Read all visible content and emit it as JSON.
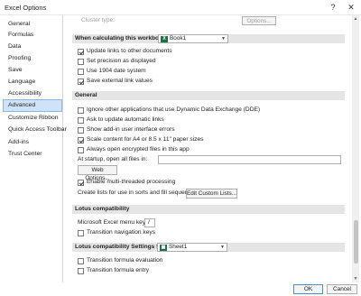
{
  "window": {
    "title": "Excel Options",
    "help": "?",
    "close": "✕"
  },
  "sidebar": {
    "items": [
      {
        "label": "General"
      },
      {
        "label": "Formulas"
      },
      {
        "label": "Data"
      },
      {
        "label": "Proofing"
      },
      {
        "label": "Save"
      },
      {
        "label": "Language"
      },
      {
        "label": "Accessibility"
      },
      {
        "label": "Advanced"
      },
      {
        "label": "Customize Ribbon"
      },
      {
        "label": "Quick Access Toolbar"
      },
      {
        "label": "Add-ins"
      },
      {
        "label": "Trust Center"
      }
    ],
    "active_index": 7
  },
  "content": {
    "cluster": {
      "label": "Cluster type:",
      "button": "Options..."
    },
    "calc_section": {
      "title": "When calculating this workbook:",
      "workbook": "Book1"
    },
    "calc_options": [
      {
        "label": "Update links to other documents",
        "checked": true
      },
      {
        "label": "Set precision as displayed",
        "checked": false
      },
      {
        "label": "Use 1904 date system",
        "checked": false
      },
      {
        "label": "Save external link values",
        "checked": true
      }
    ],
    "general_section": {
      "title": "General"
    },
    "general_options": [
      {
        "label": "Ignore other applications that use Dynamic Data Exchange (DDE)",
        "checked": false
      },
      {
        "label": "Ask to update automatic links",
        "checked": false
      },
      {
        "label": "Show add-in user interface errors",
        "checked": false
      },
      {
        "label": "Scale content for A4 or 8.5 x 11\" paper sizes",
        "checked": true
      },
      {
        "label": "Always open encrypted files in this app",
        "checked": false
      }
    ],
    "startup": {
      "label": "At startup, open all files in:",
      "value": ""
    },
    "web_options_button": "Web Options...",
    "multithreaded": {
      "label": "Enable multi-threaded processing",
      "checked": true
    },
    "custom_lists": {
      "label": "Create lists for use in sorts and fill sequences:",
      "button": "Edit Custom Lists..."
    },
    "lotus_section": {
      "title": "Lotus compatibility"
    },
    "menu_key": {
      "label": "Microsoft Excel menu key:",
      "value": "/"
    },
    "nav_keys": {
      "label": "Transition navigation keys",
      "checked": false
    },
    "lotus_settings_section": {
      "title": "Lotus compatibility Settings for:",
      "sheet": "Sheet1"
    },
    "lotus_settings_options": [
      {
        "label": "Transition formula evaluation",
        "checked": false
      },
      {
        "label": "Transition formula entry",
        "checked": false
      }
    ]
  },
  "footer": {
    "ok": "OK",
    "cancel": "Cancel"
  }
}
